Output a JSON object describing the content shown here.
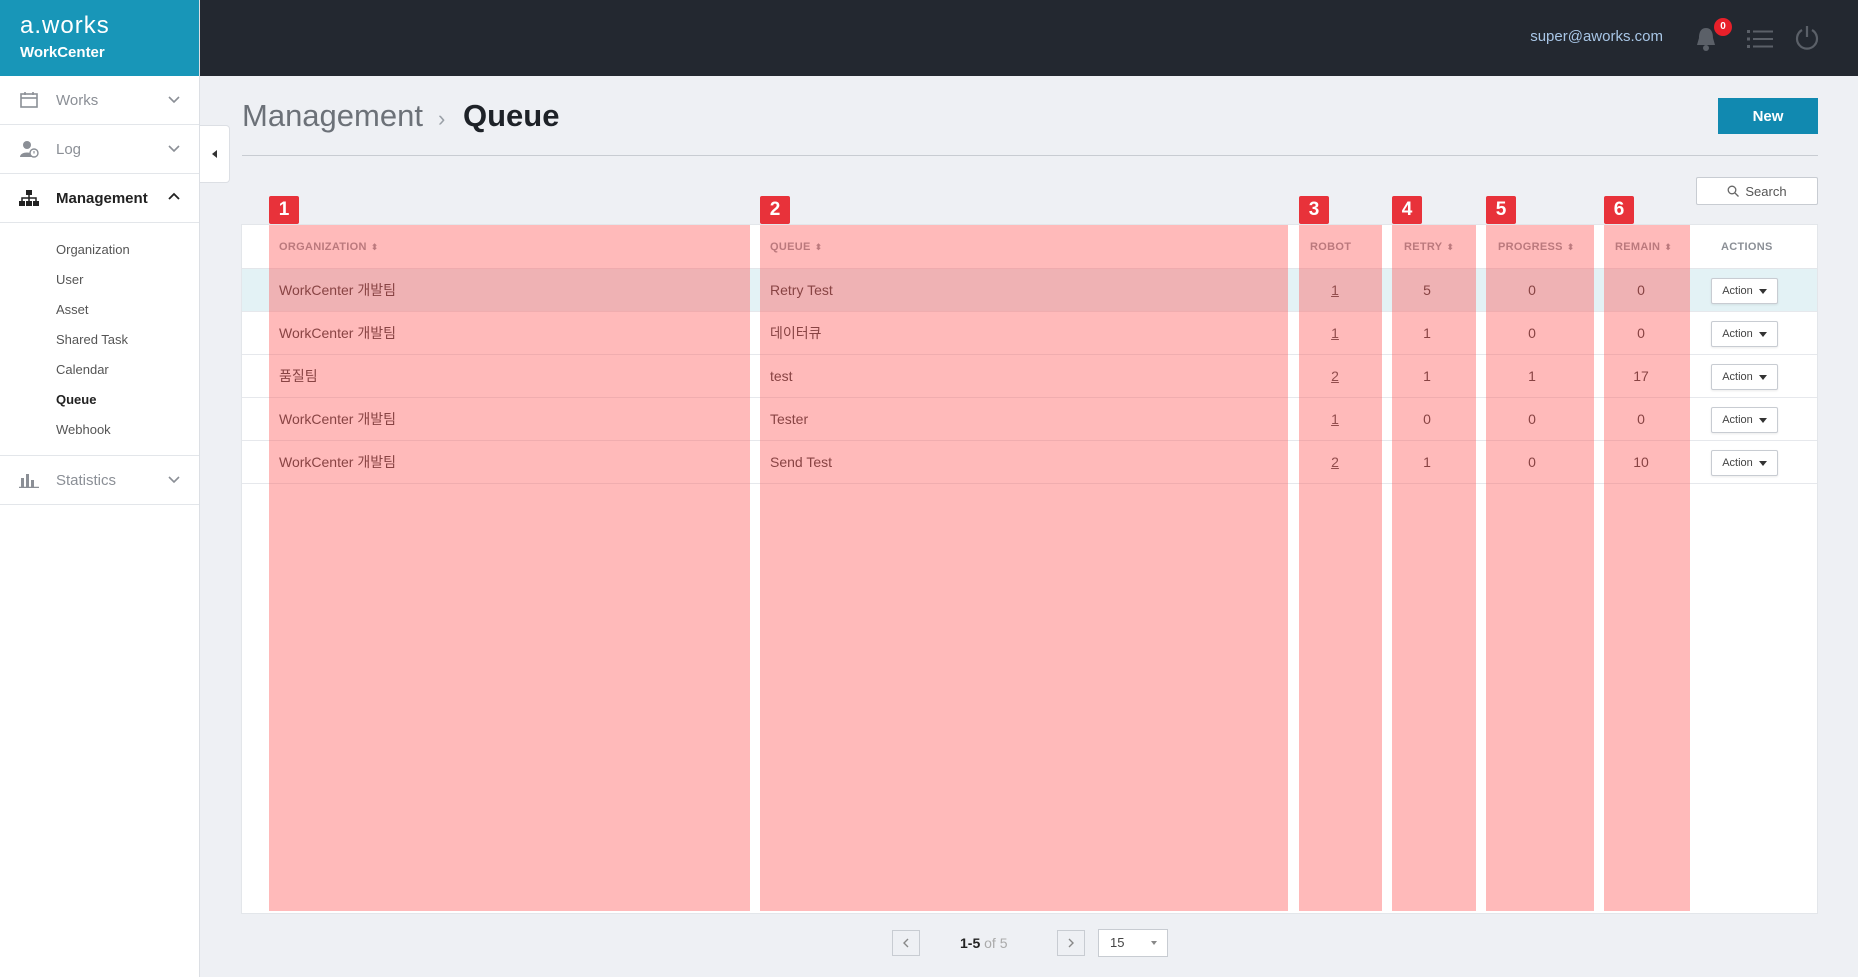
{
  "brand": {
    "logo": "a.works",
    "product": "WorkCenter"
  },
  "topbar": {
    "user_email": "super@aworks.com",
    "notification_count": "0"
  },
  "sidebar": {
    "items": [
      {
        "label": "Works",
        "icon": "calendar-icon"
      },
      {
        "label": "Log",
        "icon": "user-log-icon"
      },
      {
        "label": "Management",
        "icon": "hierarchy-icon"
      },
      {
        "label": "Statistics",
        "icon": "bar-chart-icon"
      }
    ],
    "management_sub": [
      "Organization",
      "User",
      "Asset",
      "Shared Task",
      "Calendar",
      "Queue",
      "Webhook"
    ],
    "current_sub": "Queue"
  },
  "header": {
    "breadcrumb_root": "Management",
    "separator": "›",
    "title": "Queue",
    "new_label": "New"
  },
  "search": {
    "label": "Search"
  },
  "table": {
    "columns": [
      "ORGANIZATION",
      "QUEUE",
      "ROBOT",
      "RETRY",
      "PROGRESS",
      "REMAIN",
      "ACTIONS"
    ],
    "rows": [
      {
        "organization": "WorkCenter 개발팀",
        "queue": "Retry Test",
        "robot": "1",
        "retry": "5",
        "progress": "0",
        "remain": "0",
        "action": "Action"
      },
      {
        "organization": "WorkCenter 개발팀",
        "queue": "데이터큐",
        "robot": "1",
        "retry": "1",
        "progress": "0",
        "remain": "0",
        "action": "Action"
      },
      {
        "organization": "품질팀",
        "queue": "test",
        "robot": "2",
        "retry": "1",
        "progress": "1",
        "remain": "17",
        "action": "Action"
      },
      {
        "organization": "WorkCenter 개발팀",
        "queue": "Tester",
        "robot": "1",
        "retry": "0",
        "progress": "0",
        "remain": "0",
        "action": "Action"
      },
      {
        "organization": "WorkCenter 개발팀",
        "queue": "Send Test",
        "robot": "2",
        "retry": "1",
        "progress": "0",
        "remain": "10",
        "action": "Action"
      }
    ]
  },
  "annotations": [
    "1",
    "2",
    "3",
    "4",
    "5",
    "6"
  ],
  "pagination": {
    "range": "1-5",
    "of_label": "of",
    "total": "5",
    "page_size": "15"
  },
  "colors": {
    "brand": "#1896b8",
    "topbar": "#232830",
    "primary_button": "#1189b0",
    "highlight_row": "#e3f2f5",
    "overlay": "#ff5a5a",
    "marker": "#e8323a"
  }
}
